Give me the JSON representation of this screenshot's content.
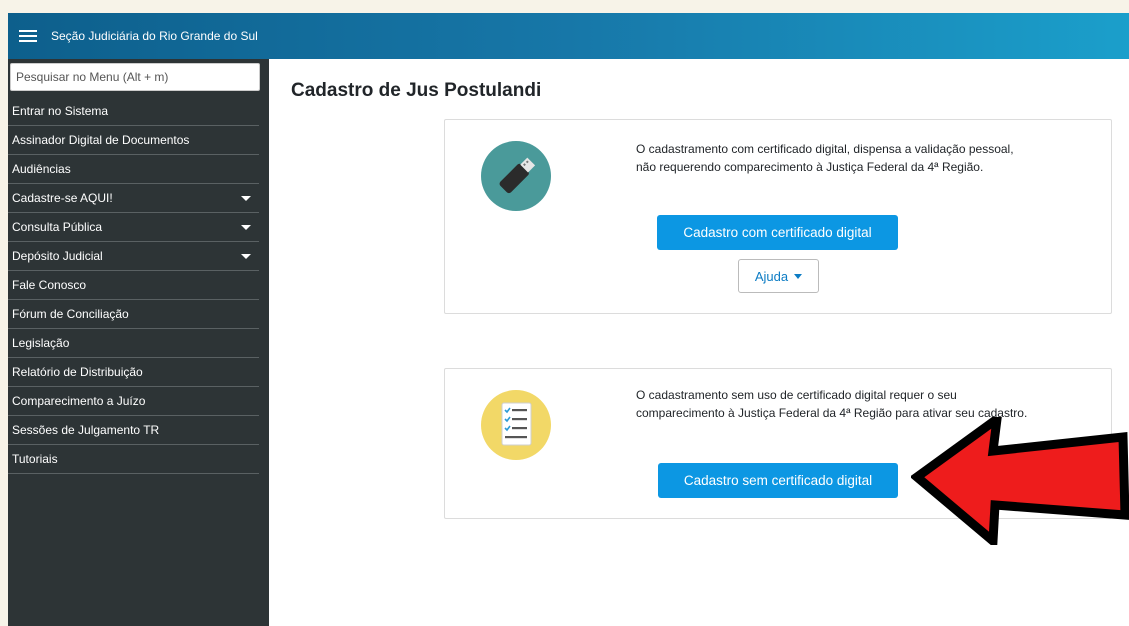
{
  "header": {
    "title": "Seção Judiciária do Rio Grande do Sul",
    "gradient_start": "#0d5f8c",
    "gradient_end": "#1b9fcb"
  },
  "sidebar": {
    "search_placeholder": "Pesquisar no Menu (Alt + m)",
    "items": [
      {
        "label": "Entrar no Sistema",
        "has_dropdown": false
      },
      {
        "label": "Assinador Digital de Documentos",
        "has_dropdown": false
      },
      {
        "label": "Audiências",
        "has_dropdown": false
      },
      {
        "label": "Cadastre-se AQUI!",
        "has_dropdown": true
      },
      {
        "label": "Consulta Pública",
        "has_dropdown": true
      },
      {
        "label": "Depósito Judicial",
        "has_dropdown": true
      },
      {
        "label": "Fale Conosco",
        "has_dropdown": false
      },
      {
        "label": "Fórum de Conciliação",
        "has_dropdown": false
      },
      {
        "label": "Legislação",
        "has_dropdown": false
      },
      {
        "label": "Relatório de Distribuição",
        "has_dropdown": false
      },
      {
        "label": "Comparecimento a Juízo",
        "has_dropdown": false
      },
      {
        "label": "Sessões de Julgamento TR",
        "has_dropdown": false
      },
      {
        "label": "Tutoriais",
        "has_dropdown": false
      }
    ]
  },
  "main": {
    "title": "Cadastro de Jus Postulandi",
    "cards": [
      {
        "icon": "usb-token-icon",
        "text_line1": "O cadastramento com certificado digital, dispensa a validação pessoal,",
        "text_line2": "não requerendo comparecimento à Justiça Federal da 4ª Região.",
        "button_label": "Cadastro com certificado digital",
        "help_label": "Ajuda"
      },
      {
        "icon": "checklist-icon",
        "text_line1": "O cadastramento sem uso de certificado digital requer o seu",
        "text_line2": "comparecimento à Justiça Federal da 4ª Região para ativar seu cadastro.",
        "button_label": "Cadastro sem certificado digital"
      }
    ]
  },
  "colors": {
    "sidebar_bg": "#2d3436",
    "primary_button": "#0c97e3",
    "annotation_arrow": "#ee1c1c"
  }
}
